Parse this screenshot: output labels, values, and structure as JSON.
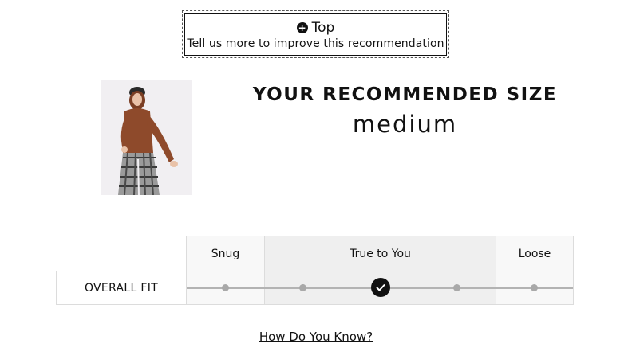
{
  "top_toggle": {
    "icon": "plus-circle-icon",
    "label": "Top",
    "subtitle": "Tell us more to improve this recommendation"
  },
  "product_image": {
    "description": "model-wearing-rust-turtleneck-sweater-and-plaid-wide-leg-pants"
  },
  "recommendation": {
    "title": "YOUR RECOMMENDED SIZE",
    "size": "medium"
  },
  "fit_table": {
    "columns": [
      "Snug",
      "True to You",
      "Loose"
    ],
    "row_label": "OVERALL FIT",
    "scale_points": 5,
    "selected_index": 2
  },
  "how_do_you_know": "How Do You Know?",
  "colors": {
    "text": "#111111",
    "border": "#dcdcdc",
    "highlight": "#efefef",
    "track": "#b3b3b3"
  }
}
